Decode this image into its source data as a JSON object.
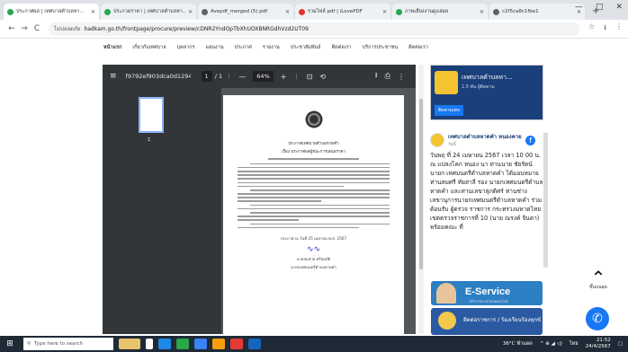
{
  "browser": {
    "tabs": [
      {
        "label": "ประกาศผล | เทศบาลตำบลหา...",
        "active": true,
        "color": "#2aa64b"
      },
      {
        "label": "ประกวดราคา | เทศบาลตำบลหา...",
        "active": false,
        "color": "#2aa64b"
      },
      {
        "label": "Avepdf_merged (5).pdf",
        "active": false,
        "color": "#5f6368"
      },
      {
        "label": "รวมไฟล์ pdf | iLovePDF",
        "active": false,
        "color": "#e5322d"
      },
      {
        "label": "ภาพเสียงงานดูแลผล",
        "active": false,
        "color": "#2aa64b"
      },
      {
        "label": "c2f5ca8c1fbe1",
        "active": false,
        "color": "#5f6368"
      }
    ],
    "new_tab": "+",
    "window_controls": [
      "—",
      "□",
      "✕"
    ],
    "nav": {
      "back": "←",
      "forward": "→",
      "reload": "C"
    },
    "security_label": "ไม่ปลอดภัย",
    "url": "hadkam.go.th/frontpage/procure/preview/cDNR2YndOpTbXhUOXBNRGdhVzd2UT09",
    "right_icons": [
      "☆",
      "⭳",
      "⋮"
    ]
  },
  "site_nav": {
    "items": [
      "หน้าแรก",
      "เกี่ยวกับเทศบาล",
      "บุคลากร",
      "แผนงาน",
      "ประกาศ",
      "รายงาน",
      "ประชาสัมพันธ์",
      "ติดต่อเรา",
      "บริการประชาชน",
      "ติดต่อเรา"
    ]
  },
  "pdf": {
    "menu_icon": "≡",
    "filename": "f9792ef903dca0d12940eee...",
    "page_current": "1",
    "page_total": "/ 1",
    "zoom": "64%",
    "minus": "—",
    "plus": "+",
    "fit_icon": "⊡",
    "rotate_icon": "⟲",
    "download_icon": "⭳",
    "print_icon": "⎙",
    "more_icon": "⋮",
    "thumb_number": "1",
    "doc_title": "ประกาศเทศบาลตำบลหาดคำ",
    "doc_subject": "เรื่อง ประกาศผลผู้ชนะการเสนอราคา",
    "doc_date": "ประกาศ ณ วันที่ 25 เมษายน พ.ศ. 2567",
    "signer": "นายสมชาย ศรีสมบัติ",
    "signer_role": "นายกเทศมนตรีตำบลหาดคำ"
  },
  "sidebar": {
    "fb_name": "เทศบาลตำบลหา...",
    "fb_likes": "1.5 พัน ผู้ติดตาม",
    "fb_follow": "ติดตามเพจ",
    "post_name": "เทศบาลตำบลหาดคำ หนองคาย",
    "post_sub": "วันนี้",
    "post_body": "วันพฤ ที่ 24 เมษายน 2567 เวลา 10 00 น. ณ แปลงโคก หนอง นา ท่านนาย ชัยรัตน์ นายก เทศมนตรีตำบลหาดคำ ได้มอบหมาย ท่านสมศรี ทัยสาลี รอง นายกเทศมนตรีตำบลหาดคำ และท่านเลขาสุภดิศร์ ท่านช่าง เลขานุการนายกเทศมนตรีตำบลหาดคำ ร่วมต้อนรับ ผู้ตรวจ ราชการ กระทรวงมหาดไทย เขตตรวจราชการที่ 10 (นาย ณรงค์ จินดา) พร้อมคณะ ที่",
    "eservice_label": "E-Service",
    "eservice_sub": "บริการประชาชนออนไลน์",
    "link2_label": "ติดต่อราชการ / ร้องเรียนร้องทุกข์",
    "totop_label": "ขึ้นบนสุด",
    "messenger_icon": "✆"
  },
  "taskbar": {
    "start": "⊞",
    "search_placeholder": "Type here to search",
    "weather": "36°C ฟ้าแดด",
    "lang": "ไทย",
    "time": "21:52",
    "date": "24/4/2567"
  }
}
